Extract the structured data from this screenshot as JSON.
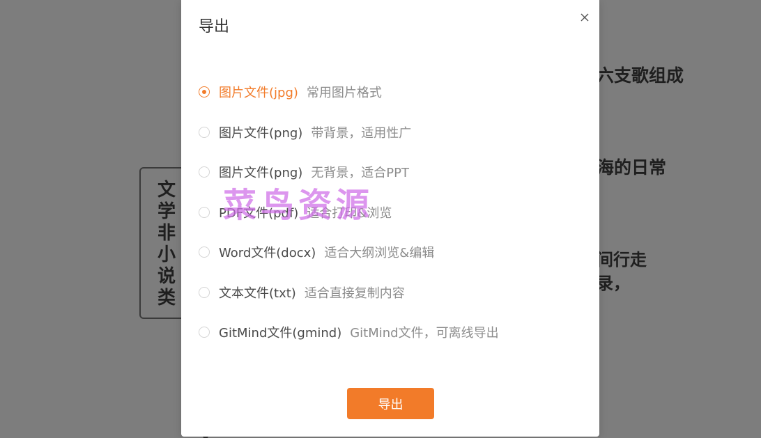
{
  "background": {
    "mindmap_fragments": [
      "六支歌组成",
      "海的日常",
      "间行走",
      "录，"
    ],
    "node_label": "文学非小说类"
  },
  "dialog": {
    "title": "导出",
    "close_label": "×",
    "options": [
      {
        "label": "图片文件(jpg)",
        "desc": "常用图片格式",
        "selected": true
      },
      {
        "label": "图片文件(png)",
        "desc": "带背景，适用性广",
        "selected": false
      },
      {
        "label": "图片文件(png)",
        "desc": "无背景，适合PPT",
        "selected": false
      },
      {
        "label": "PDF文件(pdf)",
        "desc": "适合打印&浏览",
        "selected": false
      },
      {
        "label": "Word文件(docx)",
        "desc": "适合大纲浏览&编辑",
        "selected": false
      },
      {
        "label": "文本文件(txt)",
        "desc": "适合直接复制内容",
        "selected": false
      },
      {
        "label": "GitMind文件(gmind)",
        "desc": "GitMind文件，可离线导出",
        "selected": false
      }
    ],
    "export_button": "导出"
  },
  "watermark": "菜鸟资源",
  "colors": {
    "accent": "#f27b29",
    "overlay": "#7d7d7d",
    "watermark": "#ce6ee8"
  }
}
